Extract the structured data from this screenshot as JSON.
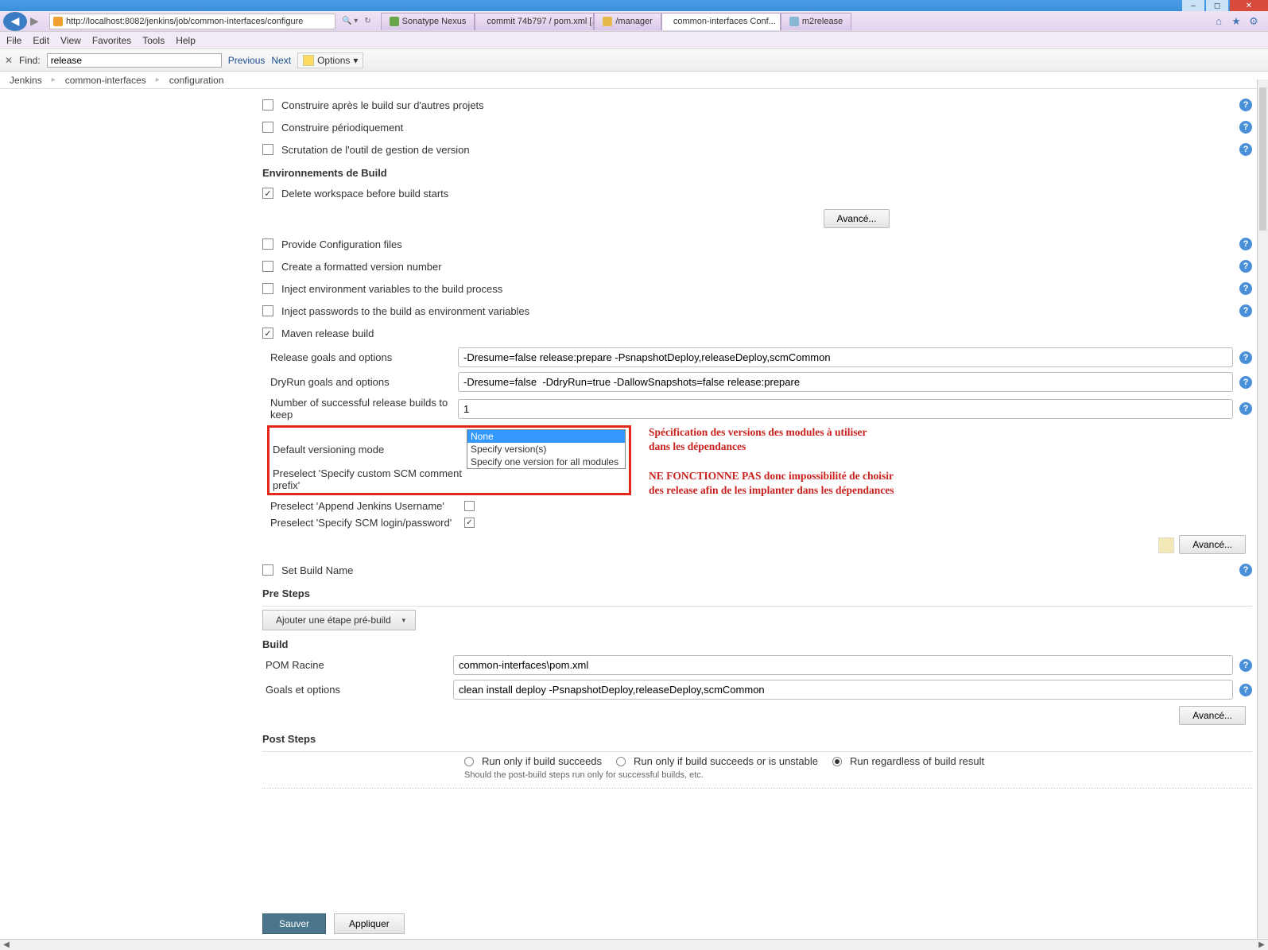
{
  "window_controls": {
    "min": "–",
    "max": "◻",
    "close": "✕"
  },
  "address_bar": {
    "url": "http://localhost:8082/jenkins/job/common-interfaces/configure",
    "search_icon": "🔍",
    "refresh_icon": "↻"
  },
  "tabs": [
    {
      "label": "Sonatype Nexus",
      "active": false,
      "icon_color": "#6aa648"
    },
    {
      "label": "commit 74b797 / pom.xml [...",
      "active": false,
      "icon_color": "#6d4fa6"
    },
    {
      "label": "/manager",
      "active": false,
      "icon_color": "#e6b94c"
    },
    {
      "label": "common-interfaces Conf...",
      "active": true,
      "icon_color": "#d36a3a",
      "closable": true
    },
    {
      "label": "m2release",
      "active": false,
      "icon_color": "#88b7d4"
    }
  ],
  "chrome_icons": {
    "home": "⌂",
    "star": "★",
    "gear": "⚙"
  },
  "menu": [
    "File",
    "Edit",
    "View",
    "Favorites",
    "Tools",
    "Help"
  ],
  "find_bar": {
    "close": "✕",
    "label": "Find:",
    "value": "release",
    "previous": "Previous",
    "next": "Next",
    "options": "Options",
    "caret": "▾"
  },
  "breadcrumb": [
    "Jenkins",
    "common-interfaces",
    "configuration"
  ],
  "rows": {
    "r1": "Construire après le build sur d'autres projets",
    "r2": "Construire périodiquement",
    "r3": "Scrutation de l'outil de gestion de version",
    "env_title": "Environnements de Build",
    "r4": "Delete workspace before build starts",
    "advanced": "Avancé...",
    "r5": "Provide Configuration files",
    "r6": "Create a formatted version number",
    "r7": "Inject environment variables to the build process",
    "r8": "Inject passwords to the build as environment variables",
    "r9": "Maven release build",
    "release_goals_label": "Release goals and options",
    "release_goals_value": "-Dresume=false release:prepare -PsnapshotDeploy,releaseDeploy,scmCommon",
    "dryrun_label": "DryRun goals and options",
    "dryrun_value": "-Dresume=false  -DdryRun=true -DallowSnapshots=false release:prepare",
    "keep_label": "Number of successful release builds to keep",
    "keep_value": "1",
    "versioning_label": "Default versioning mode",
    "versioning_options": [
      "None",
      "Specify version(s)",
      "Specify one version for all modules"
    ],
    "preselect_scm_comment": "Preselect 'Specify custom SCM comment prefix'",
    "preselect_append_user": "Preselect 'Append Jenkins Username'",
    "preselect_scm_login": "Preselect 'Specify SCM login/password'",
    "set_build_name": "Set Build Name",
    "pre_steps": "Pre Steps",
    "add_pre_step": "Ajouter une étape pré-build",
    "build": "Build",
    "pom_label": "POM Racine",
    "pom_value": "common-interfaces\\pom.xml",
    "goals_label": "Goals et options",
    "goals_value": "clean install deploy -PsnapshotDeploy,releaseDeploy,scmCommon",
    "post_steps": "Post Steps",
    "radio1": "Run only if build succeeds",
    "radio2": "Run only if build succeeds or is unstable",
    "radio3": "Run regardless of build result",
    "post_hint": "Should the post-build steps run only for successful builds, etc.",
    "save": "Sauver",
    "apply": "Appliquer"
  },
  "annotations": {
    "a1": "Spécification des versions des modules à utiliser dans les dépendances",
    "a2": "NE FONCTIONNE PAS donc impossibilité de choisir des release afin de les implanter dans les dépendances"
  },
  "help_glyph": "?"
}
